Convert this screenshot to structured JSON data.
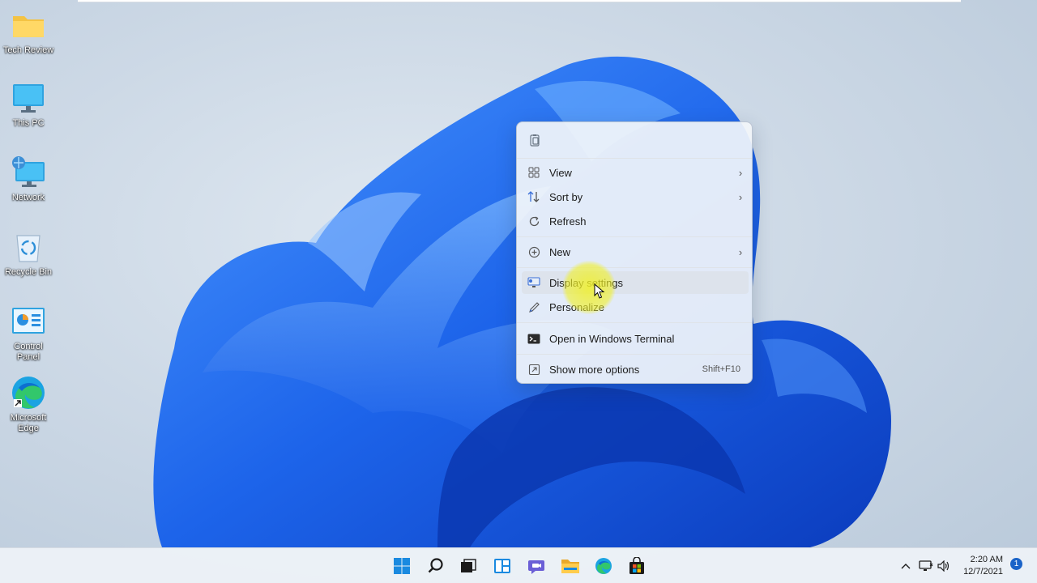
{
  "desktop": {
    "icons": [
      {
        "label": "Tech Review",
        "icon": "folder-icon"
      },
      {
        "label": "This PC",
        "icon": "monitor-icon"
      },
      {
        "label": "Network",
        "icon": "network-icon"
      },
      {
        "label": "Recycle Bin",
        "icon": "recycle-bin-icon"
      },
      {
        "label": "Control Panel",
        "icon": "control-panel-icon"
      },
      {
        "label": "Microsoft Edge",
        "icon": "edge-icon"
      }
    ]
  },
  "context_menu": {
    "items": [
      {
        "label": "View",
        "icon": "grid-view-icon",
        "submenu": true
      },
      {
        "label": "Sort by",
        "icon": "sort-icon",
        "submenu": true
      },
      {
        "label": "Refresh",
        "icon": "refresh-icon",
        "submenu": false
      },
      {
        "label": "New",
        "icon": "plus-circle-icon",
        "submenu": true
      },
      {
        "label": "Display settings",
        "icon": "display-settings-icon",
        "submenu": false,
        "highlighted": true
      },
      {
        "label": "Personalize",
        "icon": "pen-icon",
        "submenu": false
      },
      {
        "label": "Open in Windows Terminal",
        "icon": "terminal-icon",
        "submenu": false
      },
      {
        "label": "Show more options",
        "icon": "show-more-icon",
        "submenu": false,
        "shortcut": "Shift+F10"
      }
    ],
    "chevron": "›"
  },
  "taskbar": {
    "apps": [
      "start-icon",
      "search-icon",
      "task-view-icon",
      "widgets-icon",
      "teams-chat-icon",
      "file-explorer-icon",
      "edge-icon",
      "store-icon"
    ],
    "tray": {
      "time": "2:20 AM",
      "date": "12/7/2021",
      "notification_count": "1"
    }
  },
  "colors": {
    "accent": "#1a63c8",
    "wallpaper_bloom": "#1f6ff0",
    "cursor_highlight": "#f0f028"
  }
}
